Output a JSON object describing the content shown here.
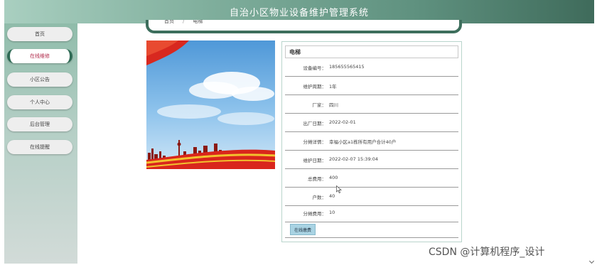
{
  "header": {
    "title": "自治小区物业设备维护管理系统"
  },
  "sidebar": {
    "items": [
      {
        "label": "首页",
        "active": false
      },
      {
        "label": "在线维修",
        "active": true
      },
      {
        "label": "小区公告",
        "active": false
      },
      {
        "label": "个人中心",
        "active": false
      },
      {
        "label": "后台管理",
        "active": false
      },
      {
        "label": "在线提醒",
        "active": false
      }
    ]
  },
  "breadcrumb": {
    "home": "首页",
    "current": "电梯"
  },
  "detail": {
    "title": "电梯",
    "rows": [
      {
        "label": "设备编号：",
        "value": "185655565415"
      },
      {
        "label": "维护周期：",
        "value": "1年"
      },
      {
        "label": "厂家：",
        "value": "四川"
      },
      {
        "label": "出厂日期：",
        "value": "2022-02-01"
      },
      {
        "label": "分摊详情：",
        "value": "幸福小区a1栋所有用户合计40户"
      },
      {
        "label": "维护日期：",
        "value": "2022-02-07 15:39:04"
      },
      {
        "label": "总费用：",
        "value": "400"
      },
      {
        "label": "户数：",
        "value": "40"
      },
      {
        "label": "分摊费用：",
        "value": "10"
      }
    ],
    "pay_button": "在线缴费"
  },
  "watermark": "CSDN @计算机程序_设计",
  "colors": {
    "header_dark": "#3f6b5b",
    "accent_active_text": "#b02a4a",
    "button_bg": "#a9d3e3"
  }
}
